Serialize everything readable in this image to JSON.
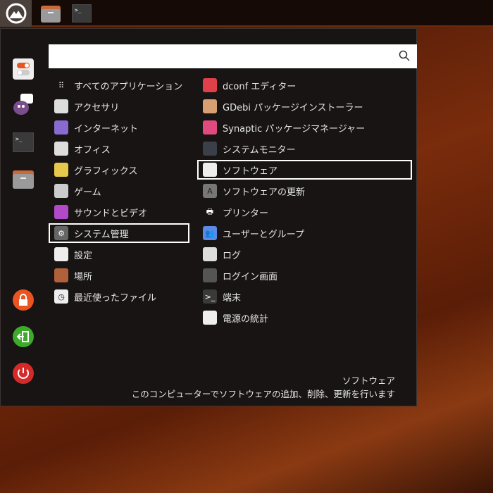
{
  "taskbar": {
    "icons": [
      "menu-logo-icon",
      "file-manager-icon",
      "terminal-icon"
    ]
  },
  "search": {
    "value": "",
    "placeholder": ""
  },
  "sidebar": {
    "favorites": [
      "settings-icon",
      "pidgin-icon",
      "terminal-icon",
      "files-icon"
    ],
    "actions": [
      "lock-icon",
      "logout-icon",
      "power-icon"
    ]
  },
  "categories": [
    {
      "label": "すべてのアプリケーション",
      "icon": "grid-icon"
    },
    {
      "label": "アクセサリ",
      "icon": "accessories-icon"
    },
    {
      "label": "インターネット",
      "icon": "internet-icon"
    },
    {
      "label": "オフィス",
      "icon": "office-icon"
    },
    {
      "label": "グラフィックス",
      "icon": "graphics-icon"
    },
    {
      "label": "ゲーム",
      "icon": "gamepad-icon"
    },
    {
      "label": "サウンドとビデオ",
      "icon": "multimedia-icon"
    },
    {
      "label": "システム管理",
      "icon": "system-gear-icon",
      "selected": true
    },
    {
      "label": "設定",
      "icon": "settings-icon"
    },
    {
      "label": "場所",
      "icon": "folder-icon"
    },
    {
      "label": "最近使ったファイル",
      "icon": "recent-clock-icon"
    }
  ],
  "apps": [
    {
      "label": "dconf エディター",
      "icon": "dconf-icon"
    },
    {
      "label": "GDebi パッケージインストーラー",
      "icon": "package-icon"
    },
    {
      "label": "Synaptic パッケージマネージャー",
      "icon": "synaptic-icon"
    },
    {
      "label": "システムモニター",
      "icon": "system-monitor-icon"
    },
    {
      "label": "ソフトウェア",
      "icon": "software-icon",
      "selected": true
    },
    {
      "label": "ソフトウェアの更新",
      "icon": "software-update-icon"
    },
    {
      "label": "プリンター",
      "icon": "printer-icon"
    },
    {
      "label": "ユーザーとグループ",
      "icon": "users-icon"
    },
    {
      "label": "ログ",
      "icon": "logs-icon"
    },
    {
      "label": "ログイン画面",
      "icon": "login-screen-icon"
    },
    {
      "label": "端末",
      "icon": "terminal-icon"
    },
    {
      "label": "電源の統計",
      "icon": "power-stats-icon"
    }
  ],
  "description": {
    "title": "ソフトウェア",
    "text": "このコンピューターでソフトウェアの追加、削除、更新を行います"
  }
}
